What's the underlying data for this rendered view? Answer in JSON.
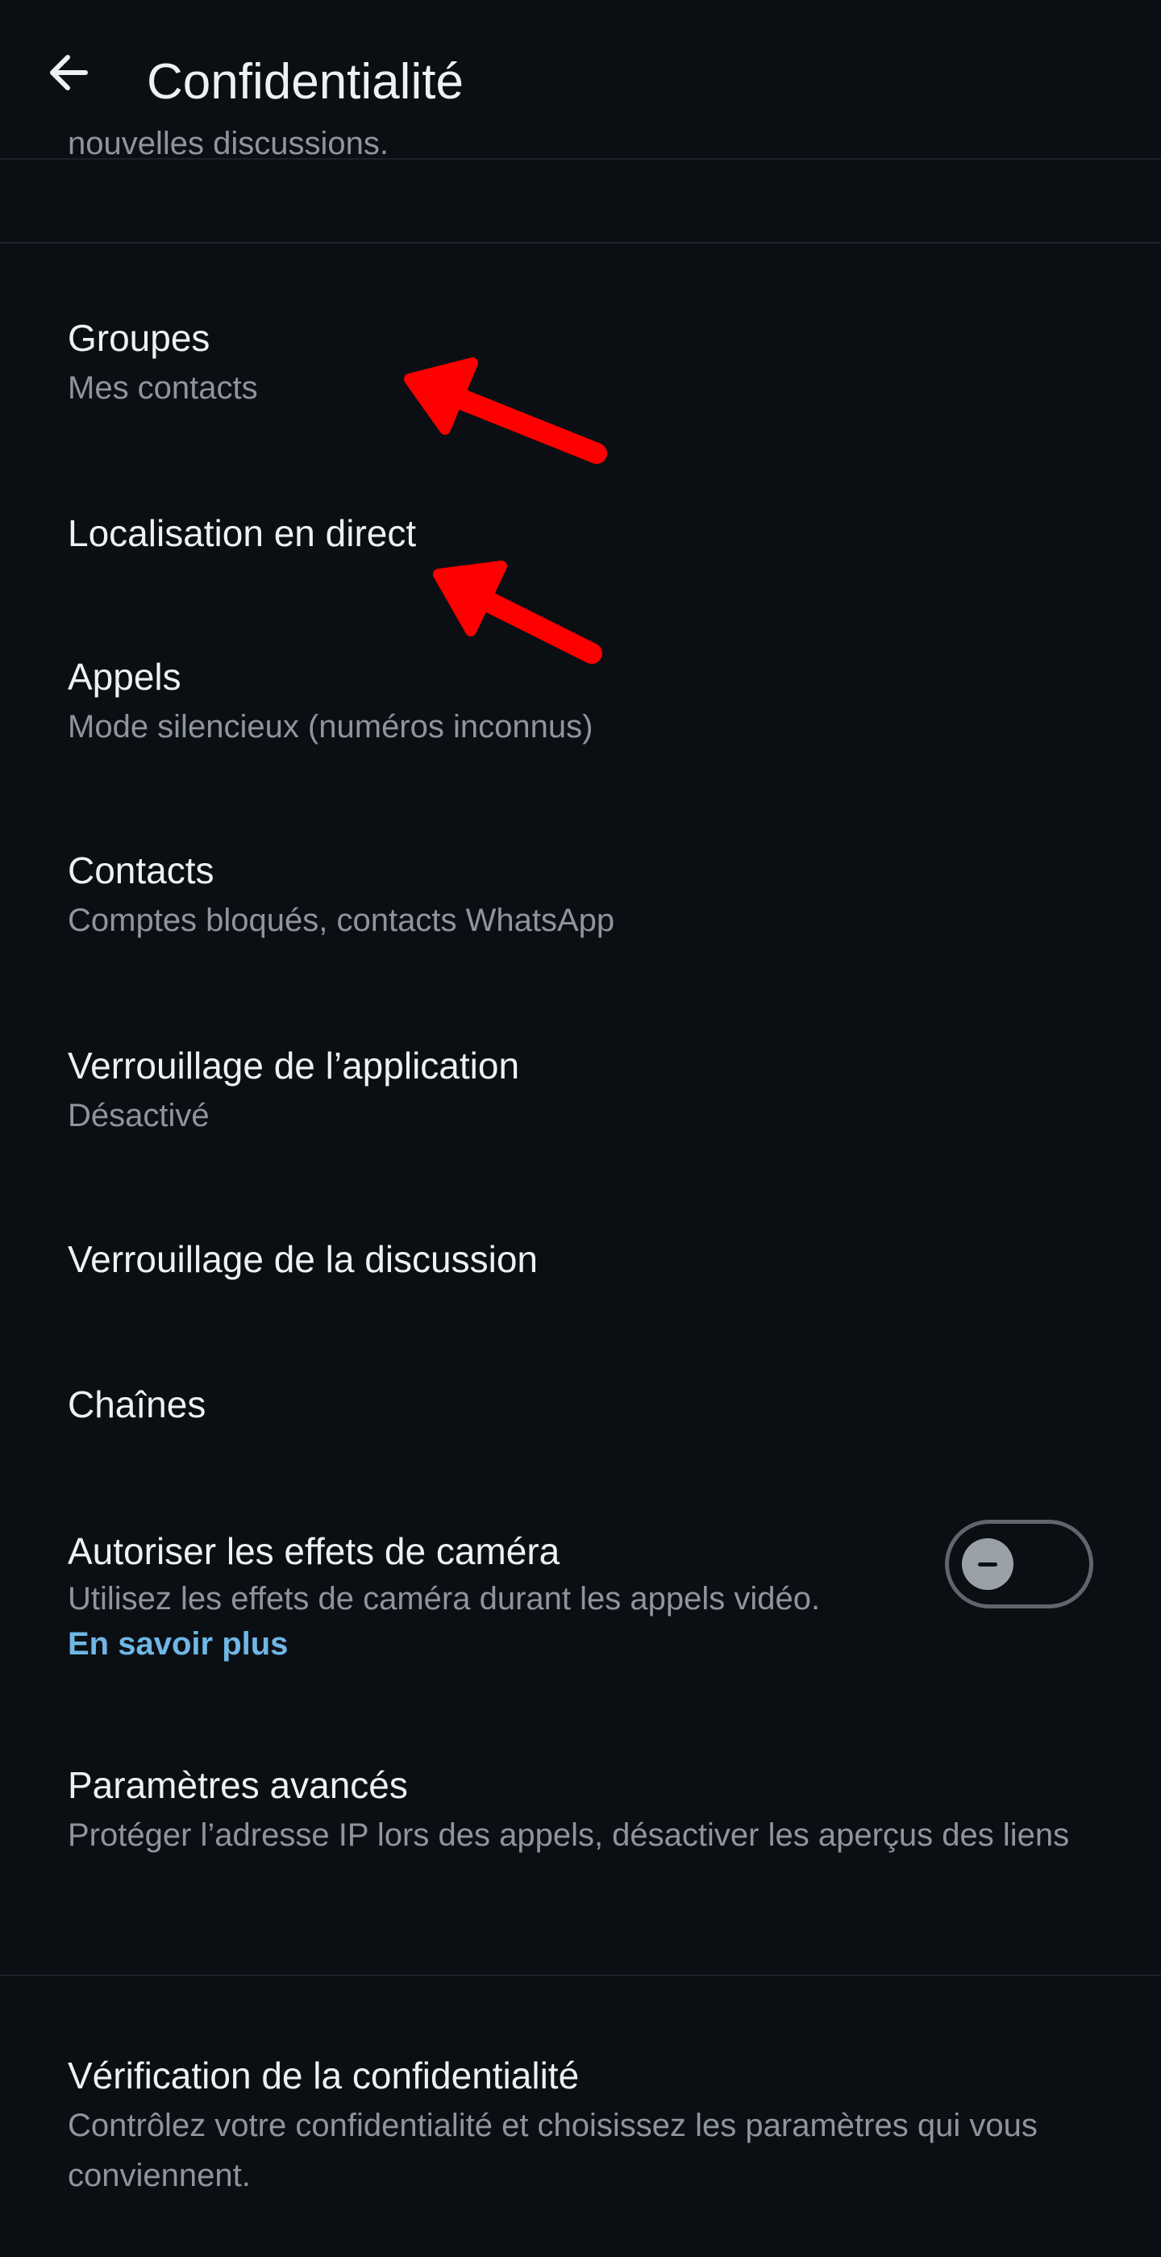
{
  "header": {
    "title": "Confidentialité",
    "clipped_text": "nouvelles discussions."
  },
  "items": [
    {
      "title": "Groupes",
      "subtitle": "Mes contacts"
    },
    {
      "title": "Localisation en direct"
    },
    {
      "title": "Appels",
      "subtitle": "Mode silencieux (numéros inconnus)"
    },
    {
      "title": "Contacts",
      "subtitle": "Comptes bloqués, contacts WhatsApp"
    },
    {
      "title": "Verrouillage de l’application",
      "subtitle": "Désactivé"
    },
    {
      "title": "Verrouillage de la discussion"
    },
    {
      "title": "Chaînes"
    },
    {
      "title": "Autoriser les effets de caméra",
      "subtitle": "Utilisez les effets de caméra durant les appels vidéo.",
      "link": "En savoir plus",
      "toggle_on": false
    },
    {
      "title": "Paramètres avancés",
      "subtitle": "Protéger l’adresse IP lors des appels, désactiver les aperçus des liens"
    },
    {
      "title": "Vérification de la confidentialité",
      "subtitle": "Contrôlez votre confidentialité et choisissez les paramètres qui vous conviennent."
    }
  ],
  "icons": {
    "back": "arrow-left-icon",
    "annotation": "red-arrow-annotation"
  },
  "colors": {
    "background": "#0b0f14",
    "primary_text": "#eef0f2",
    "secondary_text": "#8e959c",
    "link": "#6fb7e6",
    "annotation_arrow": "#ff0000"
  }
}
